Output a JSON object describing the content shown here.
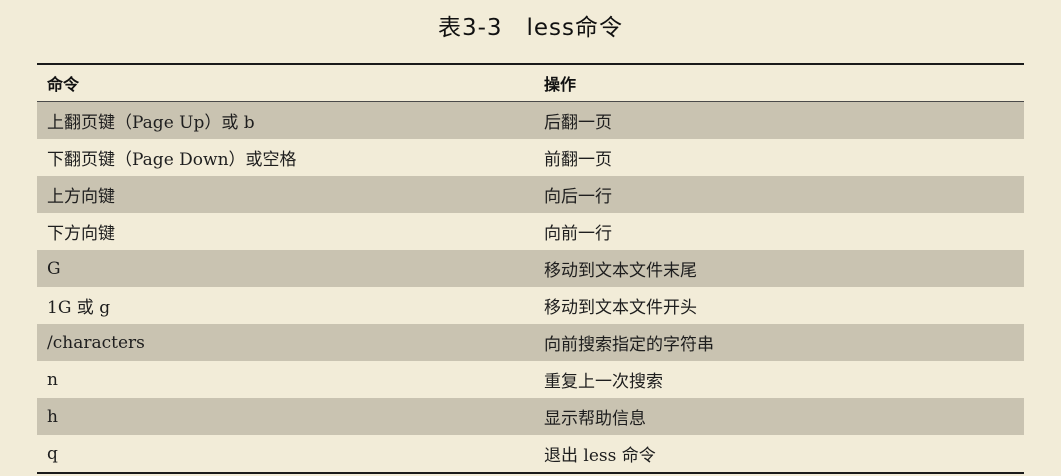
{
  "caption": "表3-3　less命令",
  "table": {
    "headers": [
      "命令",
      "操作"
    ],
    "rows": [
      [
        "上翻页键（Page Up）或 b",
        "后翻一页"
      ],
      [
        "下翻页键（Page Down）或空格",
        "前翻一页"
      ],
      [
        "上方向键",
        "向后一行"
      ],
      [
        "下方向键",
        "向前一行"
      ],
      [
        "G",
        "移动到文本文件末尾"
      ],
      [
        "1G 或 g",
        "移动到文本文件开头"
      ],
      [
        "/characters",
        "向前搜索指定的字符串"
      ],
      [
        "n",
        "重复上一次搜索"
      ],
      [
        "h",
        "显示帮助信息"
      ],
      [
        "q",
        "退出 less 命令"
      ]
    ]
  }
}
